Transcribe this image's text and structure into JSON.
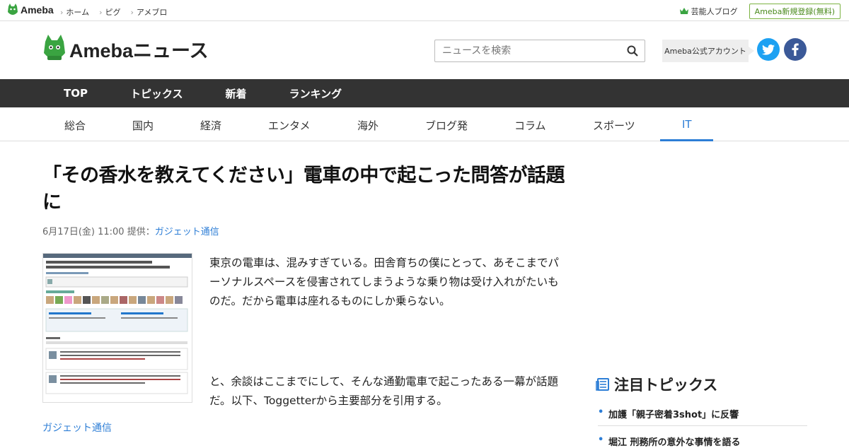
{
  "topbar": {
    "logo": "Ameba",
    "links": [
      "ホーム",
      "ピグ",
      "アメブロ"
    ],
    "celebrity_blog": "芸能人ブログ",
    "register": "Ameba新規登録(無料)"
  },
  "header": {
    "brand": "Amebaニュース",
    "search_placeholder": "ニュースを検索",
    "official_account": "Ameba公式アカウント"
  },
  "main_nav": [
    "TOP",
    "トピックス",
    "新着",
    "ランキング"
  ],
  "category_nav": {
    "items": [
      "総合",
      "国内",
      "経済",
      "エンタメ",
      "海外",
      "ブログ発",
      "コラム",
      "スポーツ",
      "IT"
    ],
    "active": "IT"
  },
  "article": {
    "title": "「その香水を教えてください」電車の中で起こった問答が話題に",
    "date": "6月17日(金) 11:00",
    "provider_label": "提供：",
    "provider": "ガジェット通信",
    "paragraph1": "東京の電車は、混みすぎている。田舎育ちの僕にとって、あそこまでパーソナルスペースを侵害されてしまうような乗り物は受け入れがたいものだ。だから電車は座れるものにしか乗らない。",
    "paragraph2": "と、余談はここまでにして、そんな通勤電車で起こったある一幕が話題だ。以下、Toggetterから主要部分を引用する。",
    "source_link": "ガジェット通信"
  },
  "sidebar": {
    "title": "注目トピックス",
    "items": [
      "加護「親子密着3shot」に反響",
      "堀江 刑務所の意外な事情を語る"
    ]
  },
  "colors": {
    "brand_green": "#3aa441",
    "accent_blue": "#2d7ed6",
    "nav_dark": "#333333",
    "twitter": "#1da1f2",
    "facebook": "#3b5998"
  }
}
